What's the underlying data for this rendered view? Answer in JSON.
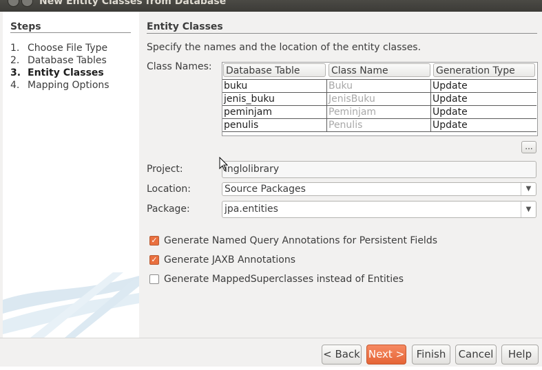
{
  "window": {
    "title": "New Entity Classes from Database"
  },
  "steps": {
    "title": "Steps",
    "items": [
      {
        "num": "1.",
        "label": "Choose File Type"
      },
      {
        "num": "2.",
        "label": "Database Tables"
      },
      {
        "num": "3.",
        "label": "Entity Classes"
      },
      {
        "num": "4.",
        "label": "Mapping Options"
      }
    ]
  },
  "main": {
    "title": "Entity Classes",
    "description": "Specify the names and the location of the entity classes.",
    "class_names_label": "Class Names:",
    "table": {
      "headers": [
        "Database Table",
        "Class Name",
        "Generation Type"
      ],
      "rows": [
        [
          "buku",
          "Buku",
          "Update"
        ],
        [
          "jenis_buku",
          "JenisBuku",
          "Update"
        ],
        [
          "peminjam",
          "Peminjam",
          "Update"
        ],
        [
          "penulis",
          "Penulis",
          "Update"
        ]
      ]
    },
    "ellipsis_button": "...",
    "project_label": "Project:",
    "project_value": "inglolibrary",
    "location_label": "Location:",
    "location_value": "Source Packages",
    "package_label": "Package:",
    "package_value": "jpa.entities",
    "options": [
      {
        "label": "Generate Named Query Annotations for Persistent Fields",
        "checked": true
      },
      {
        "label": "Generate JAXB Annotations",
        "checked": true
      },
      {
        "label": "Generate MappedSuperclasses instead of Entities",
        "checked": false
      }
    ]
  },
  "buttons": {
    "back": "< Back",
    "next": "Next >",
    "finish": "Finish",
    "cancel": "Cancel",
    "help": "Help"
  },
  "colors": {
    "accent": "#e9703f",
    "titlebar": "#3c3b37"
  }
}
